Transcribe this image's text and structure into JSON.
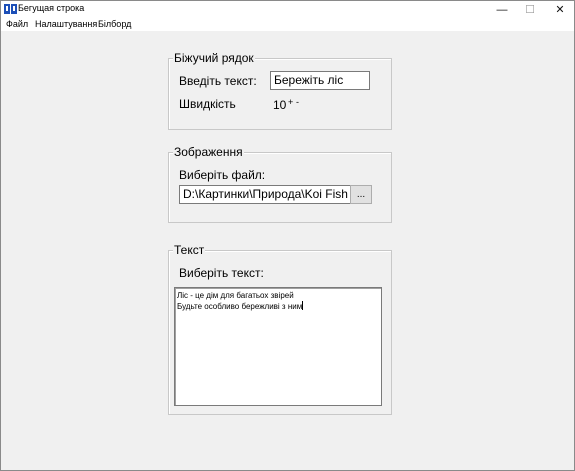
{
  "window": {
    "title": "Бегущая строка",
    "controls": {
      "minimize": "—",
      "maximize": "☐",
      "close": "✕"
    }
  },
  "menu": {
    "items": [
      "Файл",
      "Налаштування",
      "Білборд"
    ]
  },
  "running_line": {
    "group_title": "Біжучий рядок",
    "text_label": "Введіть текст:",
    "text_value": "Бережіть ліс",
    "speed_label": "Швидкість",
    "speed_value": "10",
    "speed_up": "+",
    "speed_down": "-"
  },
  "image": {
    "group_title": "Зображення",
    "file_label": "Виберіть файл:",
    "file_value": "D:\\Картинки\\Природа\\Koi Fish S",
    "browse_label": "..."
  },
  "text": {
    "group_title": "Текст",
    "select_label": "Виберіть текст:",
    "lines": [
      "Ліс - це дім для багатьох звірей",
      "Будьте особливо бережливі з ним"
    ]
  },
  "colors": {
    "background": "#f0f0f0",
    "icon": "#1c4fb8"
  }
}
